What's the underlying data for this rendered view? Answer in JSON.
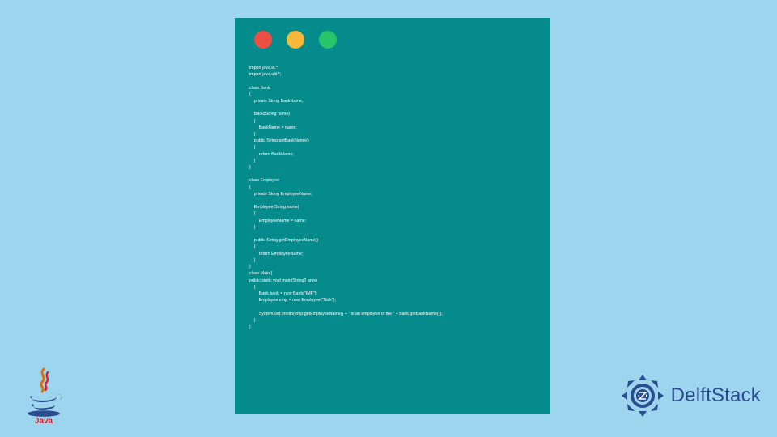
{
  "window": {
    "dots": [
      "red",
      "yellow",
      "green"
    ]
  },
  "code": "import java.io.*;\nimport java.util.*;\n\nclass Bank\n{\n    private String BankName;\n\n    Bank(String name)\n    {\n        BankName = name;\n    }\n    public String getBankName()\n    {\n        return BankName;\n    }\n}\n\nclass Employee\n{\n    private String EmployeeName;\n\n    Employee(String name)\n    {\n        EmployeeName = name;\n    }\n\n    public String getEmployeeName()\n    {\n        return EmployeeName;\n    }\n}\nclass Main {\npublic static void main(String[] args)\n    {\n        Bank bank = new Bank(\"IMF\");\n        Employee emp = new Employee(\"Nick\");\n\n        System.out.println(emp.getEmployeeName() + \" is an employee of the \" + bank.getBankName());\n    }\n}",
  "logos": {
    "java": "Java",
    "delft": "DelftStack"
  },
  "colors": {
    "background": "#9dd4ee",
    "window": "#068b8c",
    "dot_red": "#ec5044",
    "dot_yellow": "#f6b93b",
    "dot_green": "#27c46a",
    "java_red": "#d9202a",
    "java_orange": "#e76f00",
    "delft_blue": "#2a4c8e"
  }
}
